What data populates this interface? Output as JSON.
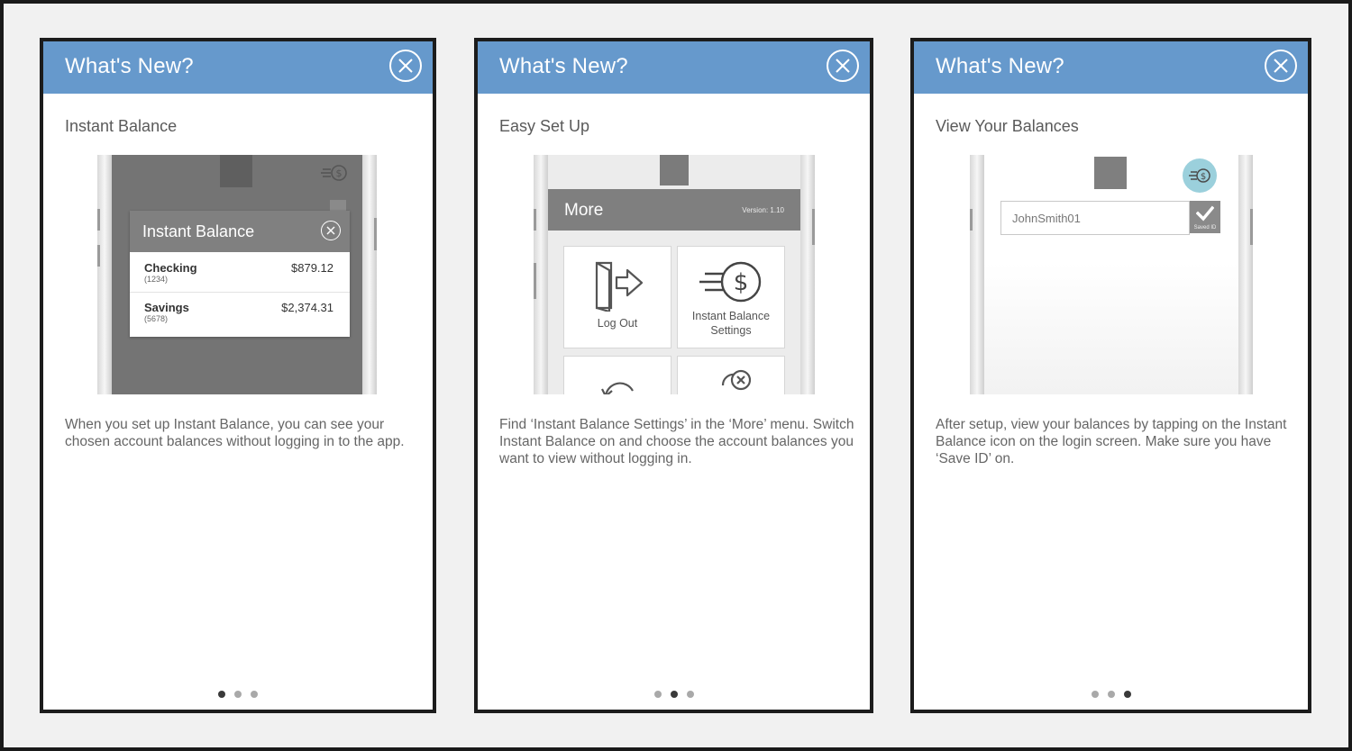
{
  "cards": [
    {
      "title": "What's New?",
      "subtitle": "Instant Balance",
      "description": "When you set up Instant Balance, you can see your chosen account balances without logging in to the app.",
      "mock": {
        "modal_title": "Instant Balance",
        "accounts": [
          {
            "name": "Checking",
            "number": "(1234)",
            "balance": "$879.12"
          },
          {
            "name": "Savings",
            "number": "(5678)",
            "balance": "$2,374.31"
          }
        ]
      },
      "active_dot": 1
    },
    {
      "title": "What's New?",
      "subtitle": "Easy Set Up",
      "description": "Find ‘Instant Balance Settings’ in the ‘More’ menu. Switch Instant Balance on and choose the account balances you want to view without logging in.",
      "mock": {
        "menu_title": "More",
        "version": "Version: 1.10",
        "tiles": [
          {
            "label": "Log Out"
          },
          {
            "label_line1": "Instant Balance",
            "label_line2": "Settings"
          }
        ]
      },
      "active_dot": 2
    },
    {
      "title": "What's New?",
      "subtitle": "View Your Balances",
      "description": "After setup, view your balances by tapping on the Instant Balance icon on the login screen. Make sure you have ‘Save ID’ on.",
      "mock": {
        "user_id": "JohnSmith01",
        "saved_label": "Saved ID"
      },
      "active_dot": 3
    }
  ],
  "colors": {
    "header": "#6699cc",
    "dot_active": "#3a3a3a",
    "dot_inactive": "#a9a9a9",
    "instant_balance_icon_bg": "#9bd0dc"
  }
}
